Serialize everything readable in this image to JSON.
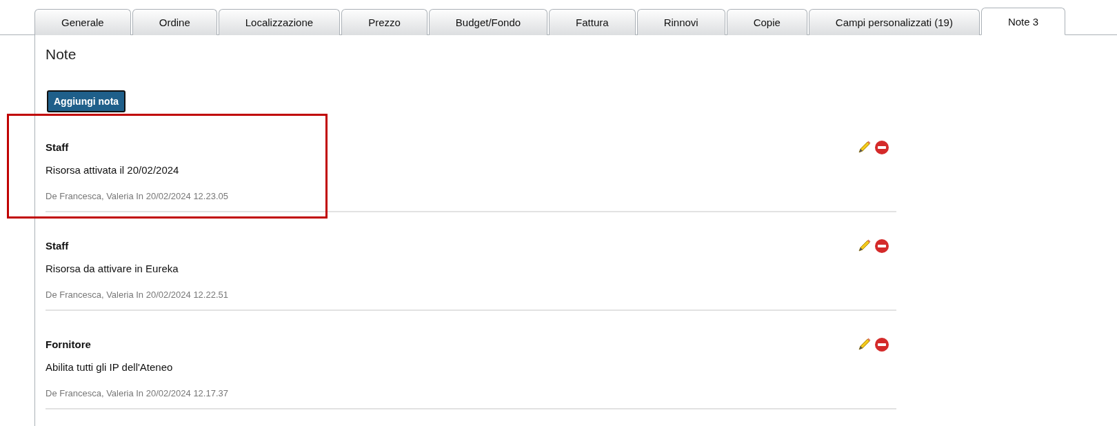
{
  "tabs": [
    {
      "label": "Generale",
      "selected": false
    },
    {
      "label": "Ordine",
      "selected": false
    },
    {
      "label": "Localizzazione",
      "selected": false
    },
    {
      "label": "Prezzo",
      "selected": false
    },
    {
      "label": "Budget/Fondo",
      "selected": false
    },
    {
      "label": "Fattura",
      "selected": false
    },
    {
      "label": "Rinnovi",
      "selected": false
    },
    {
      "label": "Copie",
      "selected": false
    },
    {
      "label": "Campi personalizzati (19)",
      "selected": false
    },
    {
      "label": "Note 3",
      "selected": true
    }
  ],
  "section_title": "Note",
  "add_button": "Aggiungi nota",
  "notes": [
    {
      "type": "Staff",
      "text": "Risorsa attivata il 20/02/2024",
      "meta": "De Francesca, Valeria In 20/02/2024 12.23.05",
      "highlighted": true
    },
    {
      "type": "Staff",
      "text": "Risorsa da attivare in Eureka",
      "meta": "De Francesca, Valeria In 20/02/2024 12.22.51",
      "highlighted": false
    },
    {
      "type": "Fornitore",
      "text": "Abilita tutti gli IP dell'Ateneo",
      "meta": "De Francesca, Valeria In 20/02/2024 12.17.37",
      "highlighted": false
    }
  ]
}
